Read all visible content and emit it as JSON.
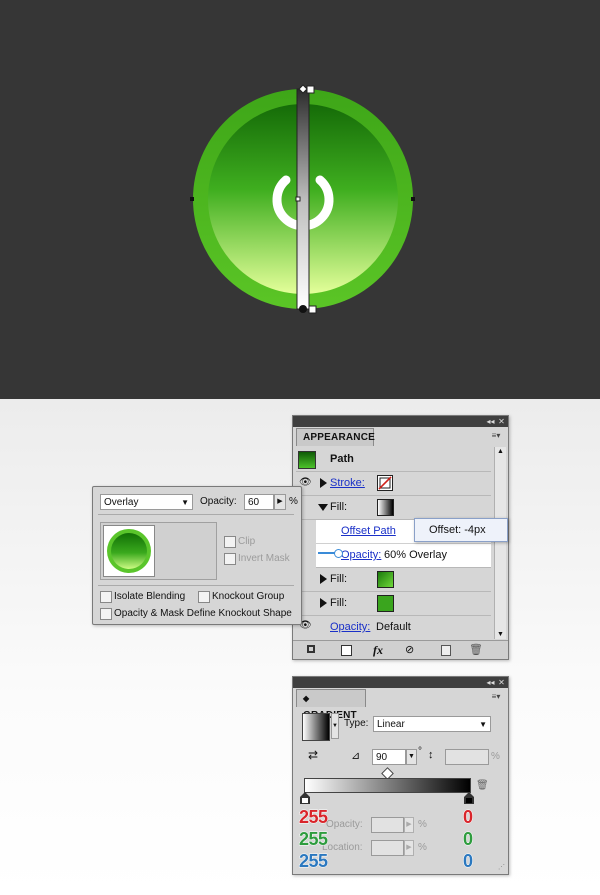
{
  "appearance_panel": {
    "title": "APPEARANCE",
    "object_label": "Path",
    "rows": [
      {
        "label": "Stroke:",
        "kind": "stroke"
      },
      {
        "label": "Fill:",
        "kind": "fill-gradient"
      },
      {
        "label": "Offset Path",
        "kind": "effect"
      },
      {
        "label": "Opacity:",
        "value": "60% Overlay",
        "kind": "opacity"
      },
      {
        "label": "Fill:",
        "kind": "fill-green-gradient"
      },
      {
        "label": "Fill:",
        "kind": "fill-green"
      },
      {
        "label": "Opacity:",
        "value": "Default",
        "kind": "opacity"
      }
    ],
    "footer_icons": [
      "new-stroke-icon",
      "new-fill-icon",
      "fx-icon",
      "clear-icon",
      "duplicate-icon",
      "trash-icon"
    ],
    "fx_label": "fx"
  },
  "offset_tooltip": {
    "text": "Offset: -4px"
  },
  "transparency_popup": {
    "blend_mode": "Overlay",
    "opacity_label": "Opacity:",
    "opacity_value": "60",
    "percent": "%",
    "clip_label": "Clip",
    "invert_mask_label": "Invert Mask",
    "isolate_blending_label": "Isolate Blending",
    "knockout_group_label": "Knockout Group",
    "opacity_mask_label": "Opacity & Mask Define Knockout Shape"
  },
  "gradient_panel": {
    "title": "GRADIENT",
    "type_label": "Type:",
    "type_value": "Linear",
    "angle_value": "90",
    "angle_symbol": "°",
    "percent": "%",
    "opacity_label": "Opacity:",
    "location_label": "Location:",
    "left_stop_rgb": [
      "255",
      "255",
      "255"
    ],
    "right_stop_rgb": [
      "0",
      "0",
      "0"
    ]
  },
  "colors": {
    "canvas_bg": "#363636",
    "button_green_dark": "#1f7a10",
    "button_green_light": "#e4ff9a",
    "ring_green": "#4fbe22",
    "rgb_red": "#d9252b",
    "rgb_green": "#2e9c3e",
    "rgb_blue": "#2b78bf"
  }
}
